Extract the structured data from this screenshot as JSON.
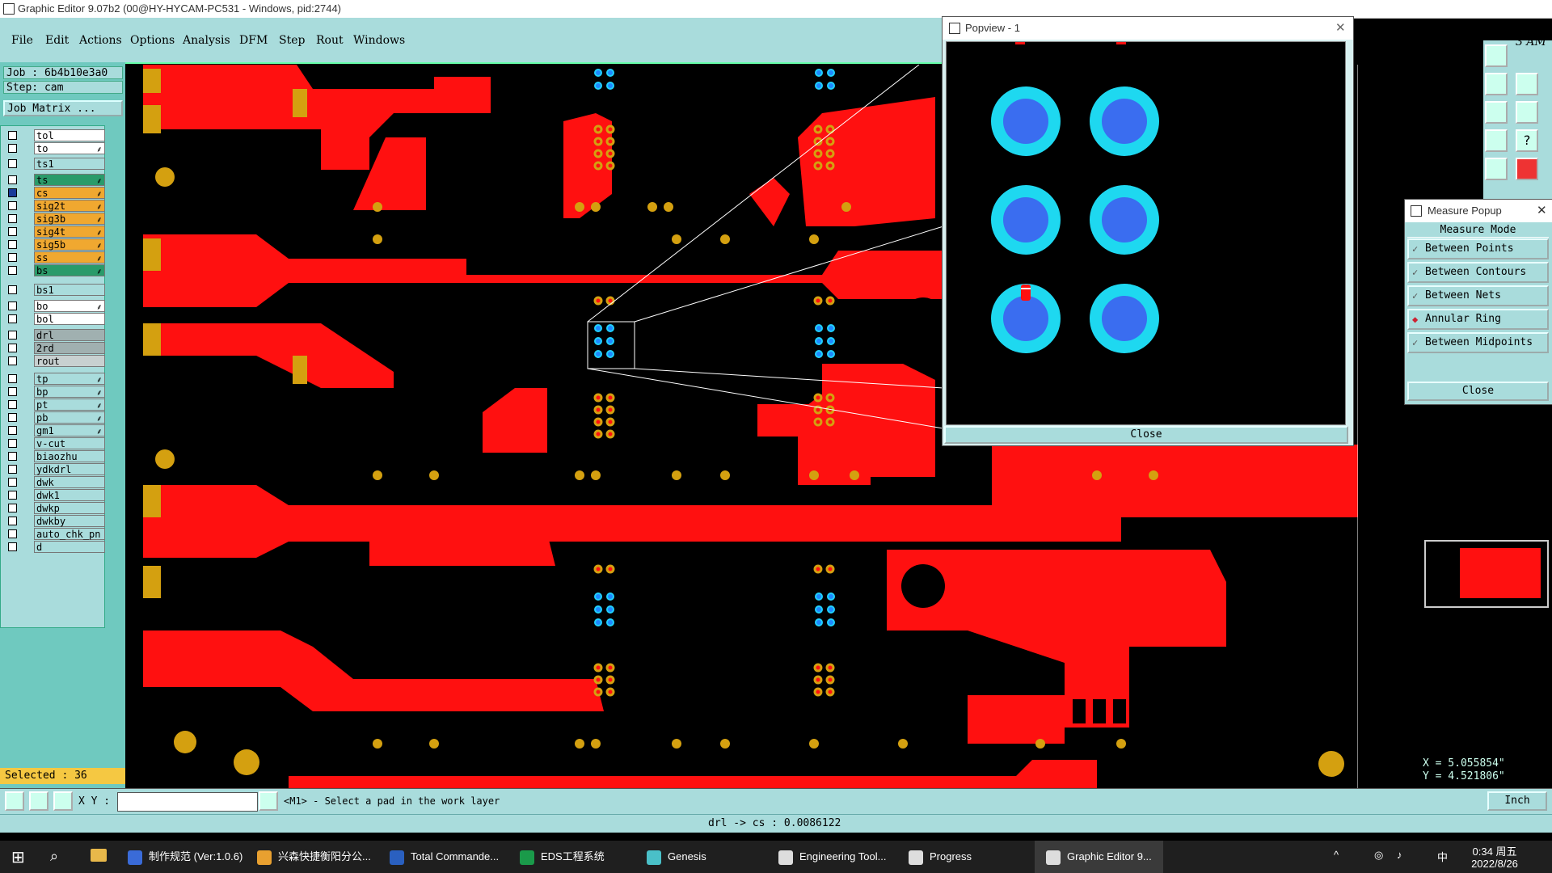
{
  "window": {
    "title": "Graphic Editor 9.07b2 (00@HY-HYCAM-PC531 - Windows, pid:2744)"
  },
  "menu": [
    "File",
    "Edit",
    "Actions",
    "Options",
    "Analysis",
    "DFM",
    "Step",
    "Rout",
    "Windows"
  ],
  "left_panel": {
    "job": "Job  : 6b4b10e3a0",
    "step": "Step: cam",
    "job_matrix_button": "Job Matrix ...",
    "layers": [
      {
        "name": "tol",
        "color": "#ffffff",
        "aff": ""
      },
      {
        "name": "to",
        "color": "#ffffff",
        "aff": "⸙"
      },
      {
        "name": "ts1",
        "color": "#a9dcdc",
        "aff": ""
      },
      {
        "name": "ts",
        "color": "#2a9b6a",
        "aff": "⸙"
      },
      {
        "name": "cs",
        "color": "#f0a830",
        "aff": "⸙"
      },
      {
        "name": "sig2t",
        "color": "#f0a830",
        "aff": "⸙"
      },
      {
        "name": "sig3b",
        "color": "#f0a830",
        "aff": "⸙"
      },
      {
        "name": "sig4t",
        "color": "#f0a830",
        "aff": "⸙"
      },
      {
        "name": "sig5b",
        "color": "#f0a830",
        "aff": "⸙"
      },
      {
        "name": "ss",
        "color": "#f0a830",
        "aff": "⸙"
      },
      {
        "name": "bs",
        "color": "#2a9b6a",
        "aff": "⸙"
      },
      {
        "name": "bs1",
        "color": "#a9dcdc",
        "aff": ""
      },
      {
        "name": "bo",
        "color": "#ffffff",
        "aff": "⸙"
      },
      {
        "name": "bol",
        "color": "#ffffff",
        "aff": ""
      },
      {
        "name": "drl",
        "color": "#a0b0b0",
        "aff": ""
      },
      {
        "name": "2rd",
        "color": "#a0b0b0",
        "aff": ""
      },
      {
        "name": "rout",
        "color": "#c8d0d0",
        "aff": ""
      },
      {
        "name": "tp",
        "color": "#a9dcdc",
        "aff": "⸙"
      },
      {
        "name": "bp",
        "color": "#a9dcdc",
        "aff": "⸙"
      },
      {
        "name": "pt",
        "color": "#a9dcdc",
        "aff": "⸙"
      },
      {
        "name": "pb",
        "color": "#a9dcdc",
        "aff": "⸙"
      },
      {
        "name": "gm1",
        "color": "#a9dcdc",
        "aff": "⸙"
      },
      {
        "name": "v-cut",
        "color": "#a9dcdc",
        "aff": ""
      },
      {
        "name": "biaozhu",
        "color": "#a9dcdc",
        "aff": ""
      },
      {
        "name": "ydkdrl",
        "color": "#a9dcdc",
        "aff": ""
      },
      {
        "name": "dwk",
        "color": "#a9dcdc",
        "aff": ""
      },
      {
        "name": "dwk1",
        "color": "#a9dcdc",
        "aff": ""
      },
      {
        "name": "dwkp",
        "color": "#a9dcdc",
        "aff": ""
      },
      {
        "name": "dwkby",
        "color": "#a9dcdc",
        "aff": ""
      },
      {
        "name": "auto_chk_pn",
        "color": "#a9dcdc",
        "aff": ""
      },
      {
        "name": "d",
        "color": "#a9dcdc",
        "aff": ""
      }
    ],
    "selected": "Selected : 36"
  },
  "popview": {
    "title": "Popview - 1",
    "close_label": "Close"
  },
  "measure_popup": {
    "title": "Measure Popup",
    "header": "Measure Mode",
    "options": [
      "Between Points",
      "Between Contours",
      "Between Nets",
      "Annular Ring",
      "Between Midpoints"
    ],
    "selected": "Annular Ring",
    "close_label": "Close"
  },
  "clock_partial": {
    "year": "2022",
    "ampm": "3 AM"
  },
  "coords": {
    "x": "X = 5.055854\"",
    "y": "Y = 4.521806\""
  },
  "status": {
    "xy_label": "X Y :",
    "xy_value": "",
    "prompt": "<M1> - Select a pad in the work layer",
    "units": "Inch"
  },
  "info_line": "drl -> cs : 0.0086122",
  "taskbar": {
    "apps": [
      {
        "label": "制作规范 (Ver:1.0.6)",
        "color": "#3a6bd8"
      },
      {
        "label": "兴森快捷衡阳分公...",
        "color": "#e8a030"
      },
      {
        "label": "Total Commande...",
        "color": "#2a60c0"
      },
      {
        "label": "EDS工程系统",
        "color": "#1a9a4a"
      },
      {
        "label": "Genesis",
        "color": "#4ac0c8"
      },
      {
        "label": "Engineering Tool...",
        "color": "#dddddd"
      },
      {
        "label": "Progress",
        "color": "#dddddd"
      },
      {
        "label": "Graphic Editor 9...",
        "color": "#dddddd"
      }
    ],
    "tray_ime": "中",
    "time": "0:34 周五",
    "date": "2022/8/26"
  }
}
